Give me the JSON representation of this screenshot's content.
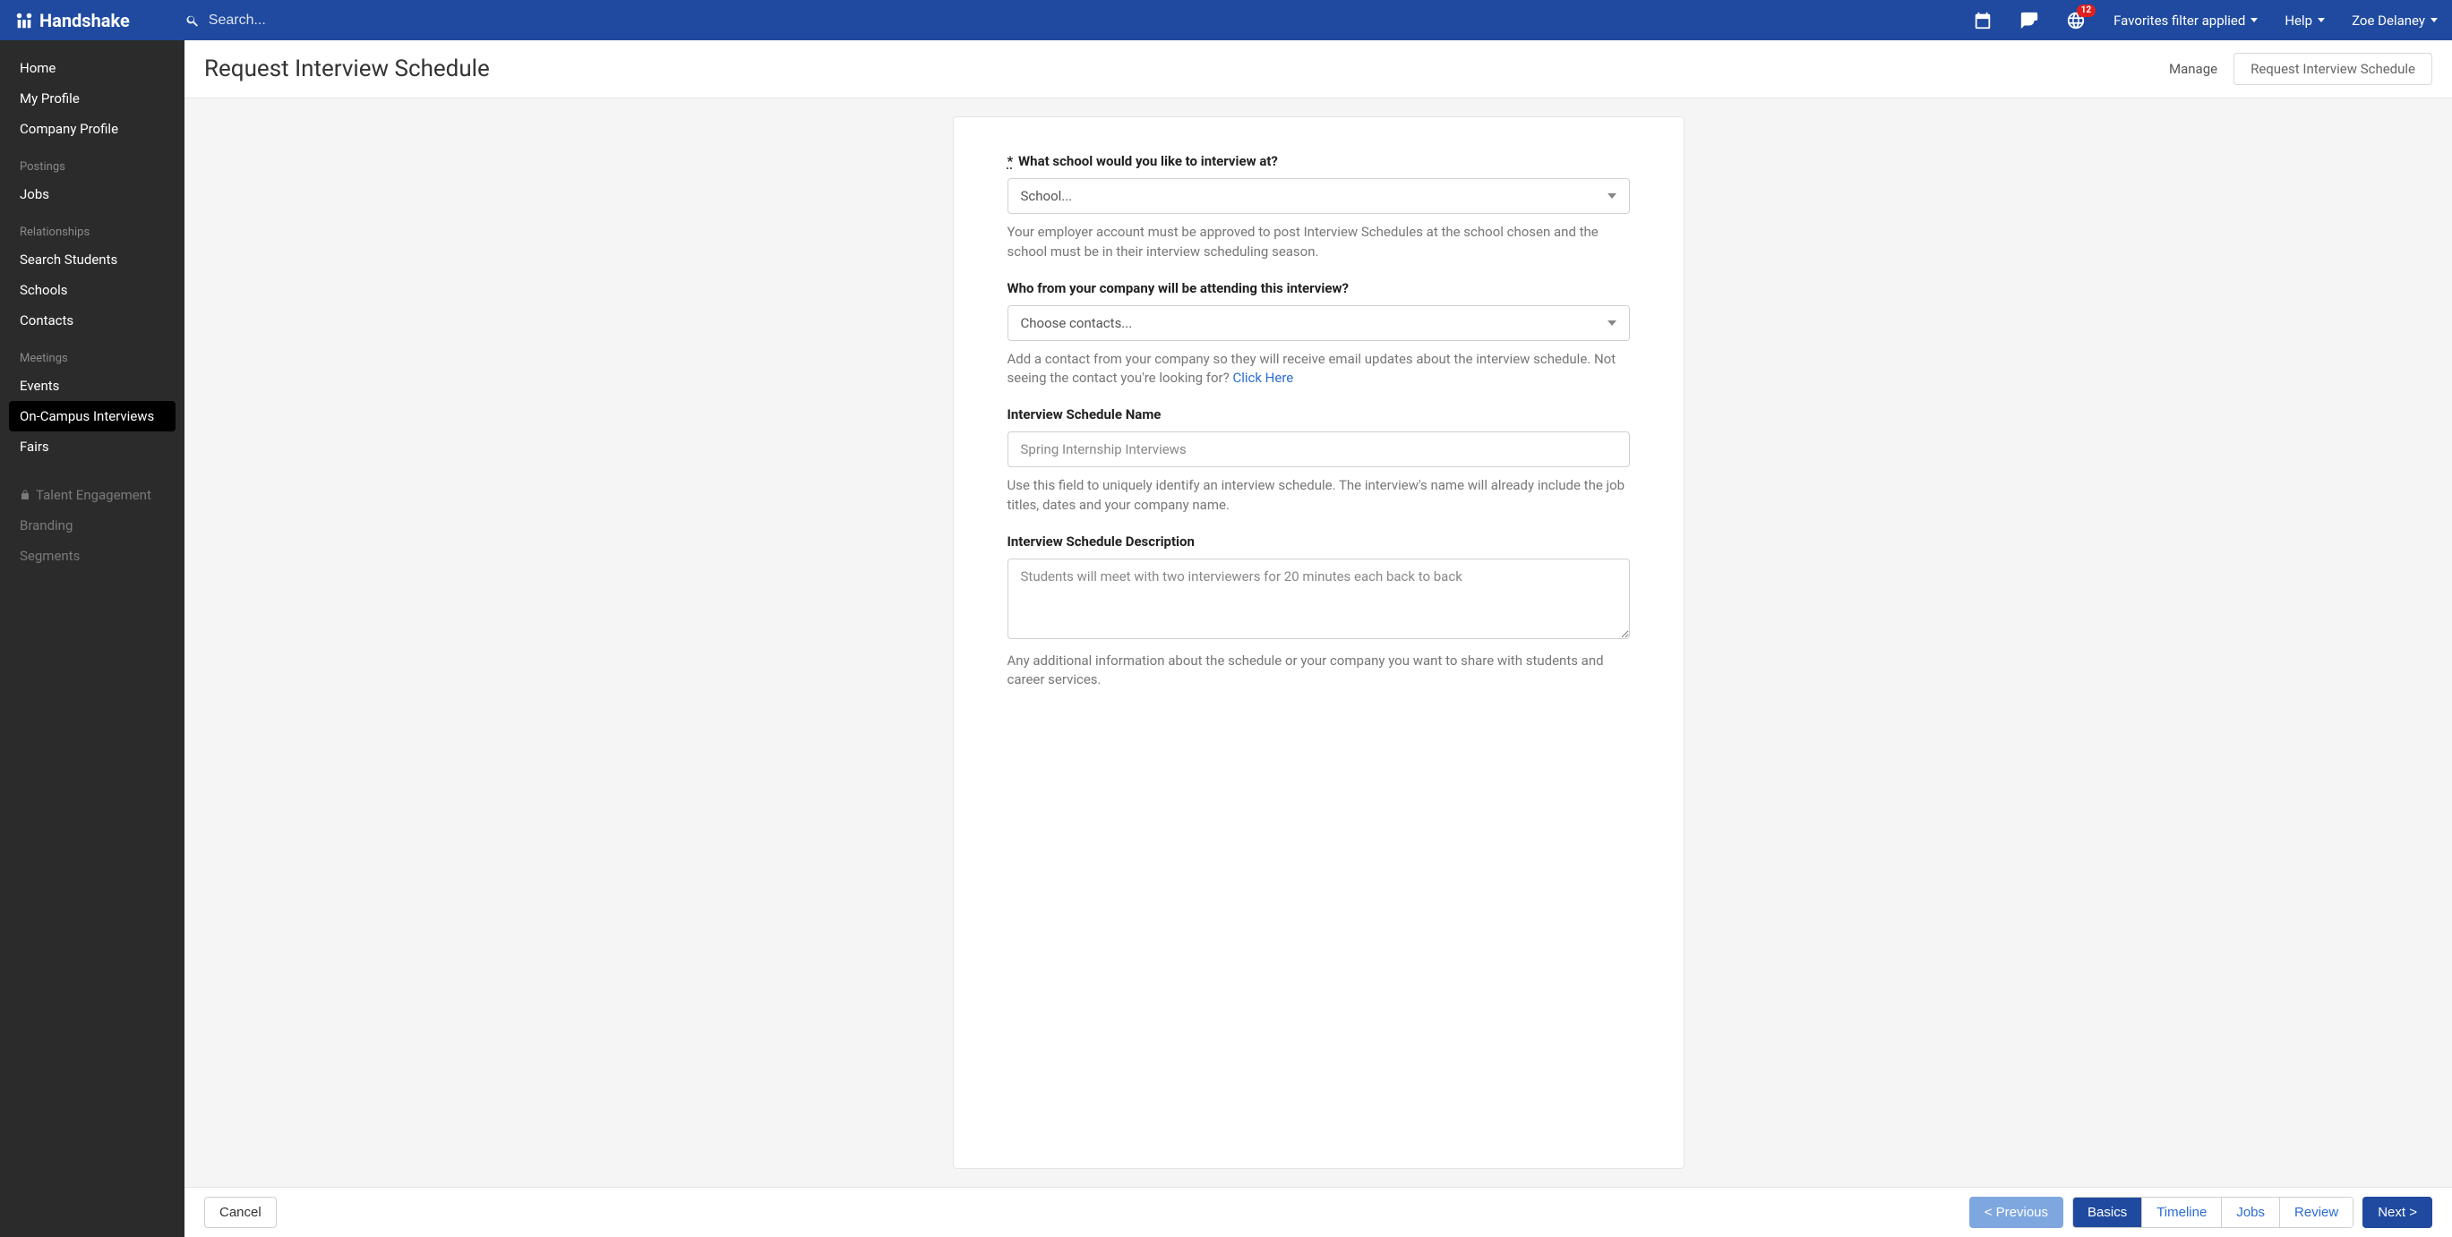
{
  "topbar": {
    "brand": "Handshake",
    "search_placeholder": "Search...",
    "badge": "12",
    "favorites": "Favorites filter applied",
    "help": "Help",
    "user": "Zoe Delaney"
  },
  "sidebar": {
    "items_top": [
      "Home",
      "My Profile",
      "Company Profile"
    ],
    "section_postings": "Postings",
    "items_postings": [
      "Jobs"
    ],
    "section_relationships": "Relationships",
    "items_relationships": [
      "Search Students",
      "Schools",
      "Contacts"
    ],
    "section_meetings": "Meetings",
    "items_meetings": [
      "Events",
      "On-Campus Interviews",
      "Fairs"
    ],
    "items_disabled": [
      "Talent Engagement",
      "Branding",
      "Segments"
    ]
  },
  "header": {
    "title": "Request Interview Schedule",
    "tab_manage": "Manage",
    "tab_request": "Request Interview Schedule"
  },
  "form": {
    "school_label": "What school would you like to interview at?",
    "school_placeholder": "School...",
    "school_help": "Your employer account must be approved to post Interview Schedules at the school chosen and the school must be in their interview scheduling season.",
    "contacts_label": "Who from your company will be attending this interview?",
    "contacts_placeholder": "Choose contacts...",
    "contacts_help_pre": "Add a contact from your company so they will receive email updates about the interview schedule. Not seeing the contact you're looking for? ",
    "contacts_help_link": "Click Here",
    "name_label": "Interview Schedule Name",
    "name_placeholder": "Spring Internship Interviews",
    "name_help": "Use this field to uniquely identify an interview schedule. The interview's name will already include the job titles, dates and your company name.",
    "desc_label": "Interview Schedule Description",
    "desc_placeholder": "Students will meet with two interviewers for 20 minutes each back to back",
    "desc_help": "Any additional information about the schedule or your company you want to share with students and career services."
  },
  "footer": {
    "cancel": "Cancel",
    "previous": "< Previous",
    "basics": "Basics",
    "timeline": "Timeline",
    "jobs": "Jobs",
    "review": "Review",
    "next": "Next >"
  }
}
